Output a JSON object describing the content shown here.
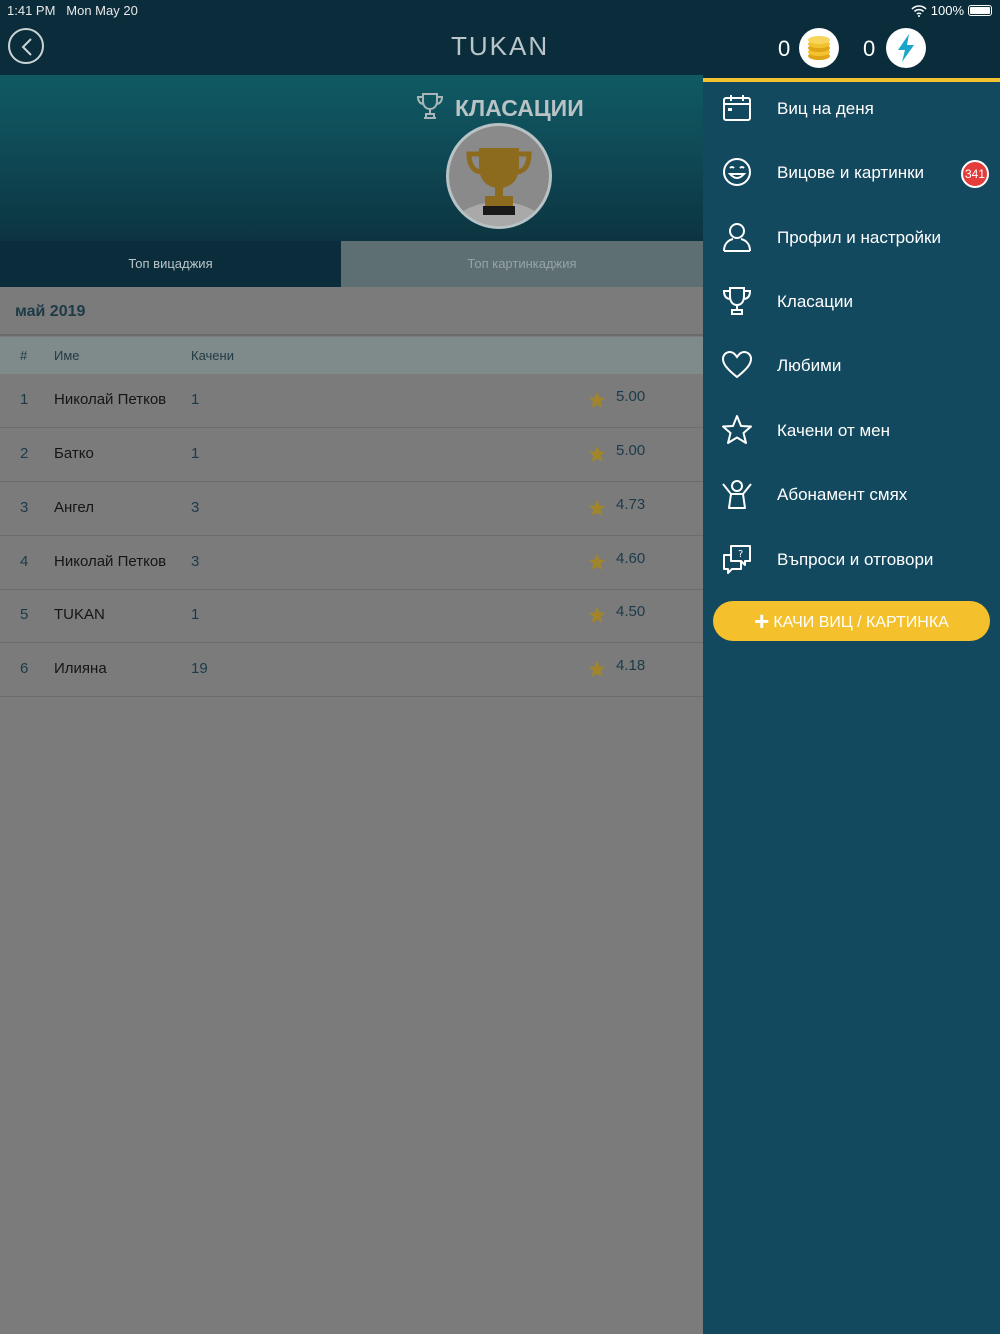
{
  "status": {
    "time": "1:41 PM",
    "date": "Mon May 20",
    "battery": "100%"
  },
  "app": {
    "title": "TUKAN"
  },
  "hero": {
    "title": "КЛАСАЦИИ"
  },
  "tabs": [
    {
      "label": "Топ вицаджия"
    },
    {
      "label": "Топ картинкаджия"
    }
  ],
  "month": "май 2019",
  "table": {
    "headers": {
      "rank": "#",
      "name": "Име",
      "uploaded": "Качени"
    },
    "rows": [
      {
        "rank": "1",
        "name": "Николай Петков",
        "uploaded": "1",
        "score": "5.00"
      },
      {
        "rank": "2",
        "name": "Батко",
        "uploaded": "1",
        "score": "5.00"
      },
      {
        "rank": "3",
        "name": "Ангел",
        "uploaded": "3",
        "score": "4.73"
      },
      {
        "rank": "4",
        "name": "Николай Петков",
        "uploaded": "3",
        "score": "4.60"
      },
      {
        "rank": "5",
        "name": "TUKAN",
        "uploaded": "1",
        "score": "4.50"
      },
      {
        "rank": "6",
        "name": "Илияна",
        "uploaded": "19",
        "score": "4.18"
      }
    ]
  },
  "menu": {
    "coins": "0",
    "energy": "0",
    "items": [
      {
        "label": "Виц на деня",
        "icon": "calendar-icon"
      },
      {
        "label": "Вицове и картинки",
        "icon": "smile-icon",
        "badge": "341"
      },
      {
        "label": "Профил и настройки",
        "icon": "user-icon"
      },
      {
        "label": "Класации",
        "icon": "trophy-icon"
      },
      {
        "label": "Любими",
        "icon": "heart-icon"
      },
      {
        "label": "Качени от мен",
        "icon": "star-icon"
      },
      {
        "label": "Абонамент смях",
        "icon": "cheer-icon"
      },
      {
        "label": "Въпроси и отговори",
        "icon": "question-chat-icon"
      }
    ],
    "upload_label": "КАЧИ ВИЦ / КАРТИНКА"
  },
  "colors": {
    "accent": "#f4c12d",
    "menu_bg": "#13495f",
    "header_bg": "#0b2d3b",
    "badge": "#e43b3b"
  }
}
